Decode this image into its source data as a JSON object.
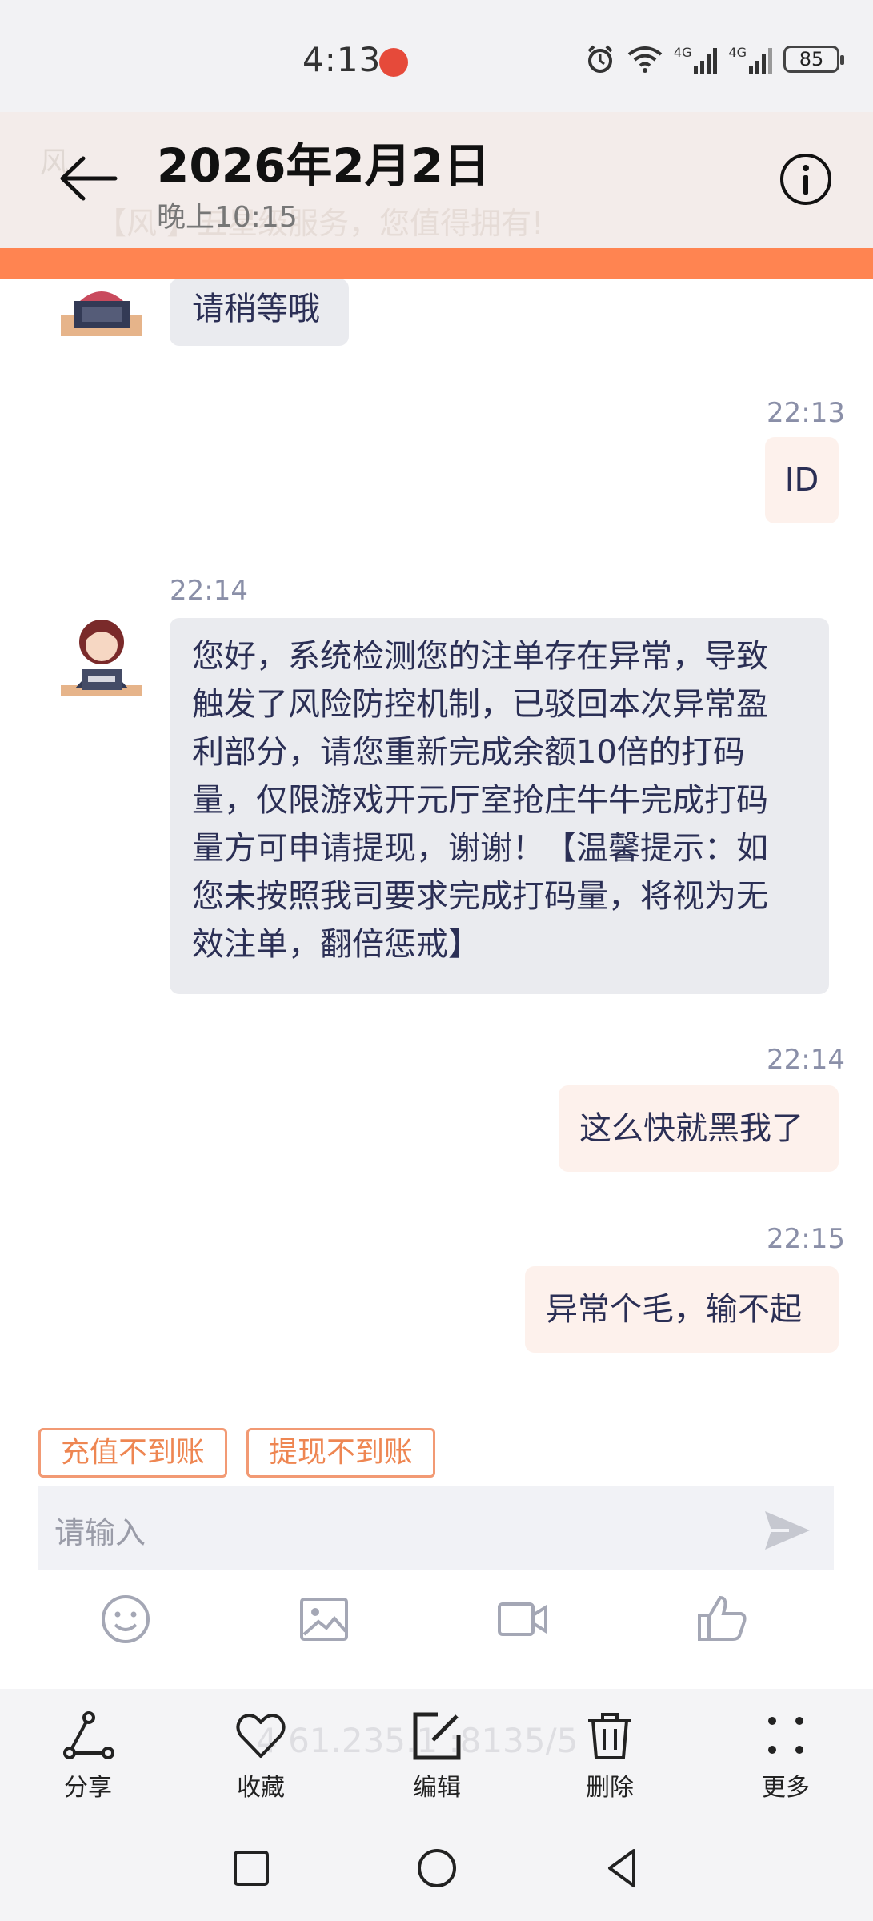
{
  "status_bar": {
    "time": "4:13",
    "battery": "85",
    "signal_1": "4G",
    "signal_2": "4G"
  },
  "header": {
    "title": "2026年2月2日",
    "subtitle": "晚上10:15",
    "ghost_title": "风",
    "ghost_subtitle": "【风 】五星级服务，您值得拥有!"
  },
  "chat": {
    "messages": [
      {
        "side": "in",
        "text": "请稍等哦"
      },
      {
        "side": "out",
        "time": "22:13",
        "text": "ID"
      },
      {
        "side": "in",
        "time": "22:14",
        "lines": [
          "您好，系统检测您的注单存在异常，导致",
          "触发了风险防控机制，已驳回本次异常盈",
          "利部分，请您重新完成余额10倍的打码",
          "量，仅限游戏开元厅室抢庄牛牛完成打码",
          "量方可申请提现，谢谢！【温馨提示：如",
          "您未按照我司要求完成打码量，将视为无",
          "效注单，翻倍惩戒】"
        ]
      },
      {
        "side": "out",
        "time": "22:14",
        "text": "这么快就黑我了"
      },
      {
        "side": "out",
        "time": "22:15",
        "text": "异常个毛，输不起"
      }
    ]
  },
  "quick_replies": [
    "充值不到账",
    "提现不到账"
  ],
  "input": {
    "placeholder": "请输入"
  },
  "toolbar": [
    "emoji-icon",
    "image-icon",
    "video-icon",
    "thumbs-up-icon"
  ],
  "action_bar": {
    "ghost_url": "4 61.235.1 :8135/5",
    "items": [
      {
        "label": "分享",
        "icon": "share-icon"
      },
      {
        "label": "收藏",
        "icon": "heart-icon"
      },
      {
        "label": "编辑",
        "icon": "edit-icon"
      },
      {
        "label": "删除",
        "icon": "trash-icon"
      },
      {
        "label": "更多",
        "icon": "more-icon"
      }
    ]
  },
  "colors": {
    "accent": "#ff8451",
    "bubble_in": "#eaebef",
    "bubble_out": "#fdf1ec",
    "chip_border": "#f29a74"
  }
}
